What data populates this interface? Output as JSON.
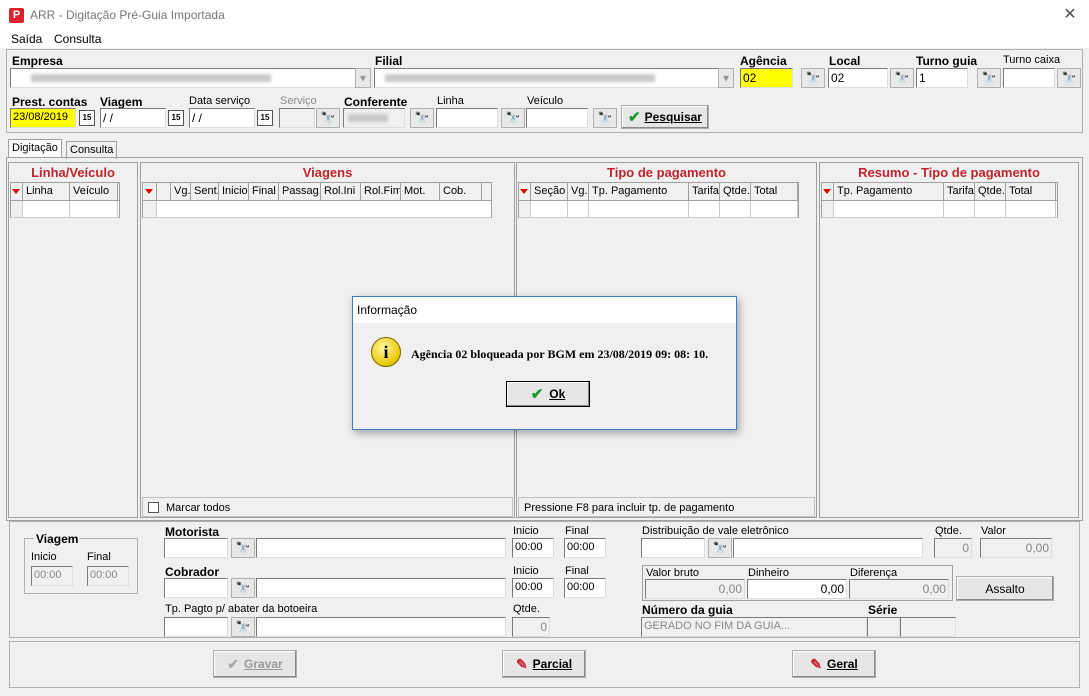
{
  "window": {
    "title": "ARR - Digitação Pré-Guia Importada",
    "app_icon": "app-logo-icon",
    "close": "✕"
  },
  "menu": [
    "Saída",
    "Consulta"
  ],
  "filters": {
    "empresa_label": "Empresa",
    "filial_label": "Filial",
    "agencia_label": "Agência",
    "agencia_value": "02",
    "local_label": "Local",
    "local_value": "02",
    "turno_guia_label": "Turno guia",
    "turno_guia_value": "1",
    "turno_caixa_label": "Turno caixa",
    "prest_contas_label": "Prest. contas",
    "prest_contas_value": "23/08/2019",
    "viagem_label": "Viagem",
    "viagem_value": "/ /",
    "data_servico_label": "Data serviço",
    "data_servico_value": "/ /",
    "servico_label": "Serviço",
    "conferente_label": "Conferente",
    "linha_label": "Linha",
    "veiculo_label": "Veículo",
    "pesquisar": "Pesquisar",
    "cal": "15"
  },
  "tabs": [
    "Digitação",
    "Consulta"
  ],
  "linha_veiculo": {
    "title": "Linha/Veículo",
    "cols": [
      "Linha",
      "Veículo"
    ]
  },
  "viagens": {
    "title": "Viagens",
    "cols": [
      "Vg.",
      "Sent.",
      "Inicio",
      "Final",
      "Passag.",
      "Rol.Ini",
      "Rol.Fim",
      "Mot.",
      "Cob."
    ],
    "marcar_todos": "Marcar todos"
  },
  "tipo_pagamento": {
    "title": "Tipo de pagamento",
    "cols": [
      "Seção",
      "Vg.",
      "Tp. Pagamento",
      "Tarifa",
      "Qtde.",
      "Total"
    ],
    "hint": "Pressione F8 para incluir tp. de pagamento"
  },
  "resumo": {
    "title": "Resumo - Tipo de pagamento",
    "cols": [
      "Tp. Pagamento",
      "Tarifa",
      "Qtde.",
      "Total"
    ]
  },
  "bottom": {
    "viagem_group": "Viagem",
    "inicio": "Inicio",
    "final": "Final",
    "time_placeholder": "00:00",
    "motorista": "Motorista",
    "cobrador": "Cobrador",
    "tp_pagto": "Tp. Pagto p/ abater da botoeira",
    "qtde": "Qtde.",
    "qtde_value": "0",
    "distribuicao": "Distribuição de vale eletrônico",
    "qtde2_value": "0",
    "valor": "Valor",
    "valor_value": "0,00",
    "valor_bruto": "Valor bruto",
    "valor_bruto_value": "0,00",
    "dinheiro": "Dinheiro",
    "dinheiro_value": "0,00",
    "diferenca": "Diferença",
    "diferenca_value": "0,00",
    "assalto": "Assalto",
    "numero_guia": "Número da guia",
    "numero_guia_value": "GERADO NO FIM DA GUIA...",
    "serie": "Série"
  },
  "actions": {
    "gravar": "Gravar",
    "parcial": "Parcial",
    "geral": "Geral"
  },
  "dialog": {
    "title": "Informação",
    "message": "Agência 02 bloqueada por BGM em 23/08/2019 09: 08: 10.",
    "ok": "Ok",
    "icon": "info-icon"
  }
}
